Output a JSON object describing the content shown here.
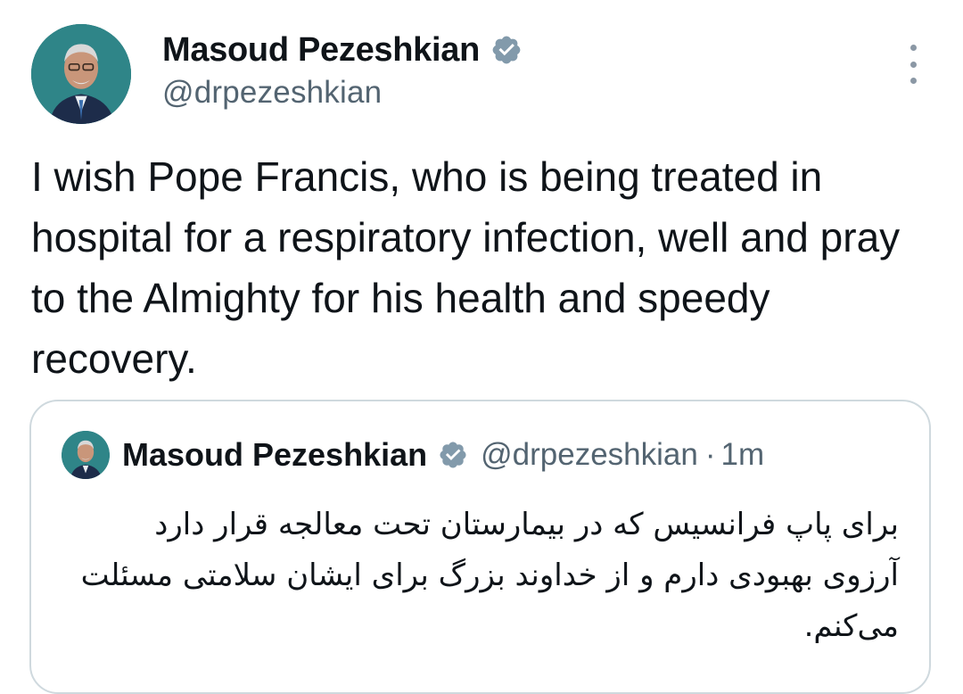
{
  "tweet": {
    "author": {
      "display_name": "Masoud Pezeshkian",
      "handle": "@drpezeshkian",
      "verified": true,
      "avatar_icon": "profile-photo"
    },
    "text": "I wish Pope Francis, who is being treated in hospital for a respiratory infection, well and pray to the Almighty for his health and speedy recovery.",
    "more_icon": "more-vertical-icon"
  },
  "quote": {
    "author": {
      "display_name": "Masoud Pezeshkian",
      "handle": "@drpezeshkian",
      "verified": true
    },
    "separator": "·",
    "time": "1m",
    "text": "برای پاپ فرانسیس که در بیمارستان تحت معالجه قرار دارد آرزوی بهبودی دارم و از خداوند بزرگ برای ایشان سلامتی مسئلت می‌کنم."
  },
  "colors": {
    "text_primary": "#0f1419",
    "text_secondary": "#536471",
    "border": "#cfd9de",
    "verified_badge": "#829aab"
  }
}
